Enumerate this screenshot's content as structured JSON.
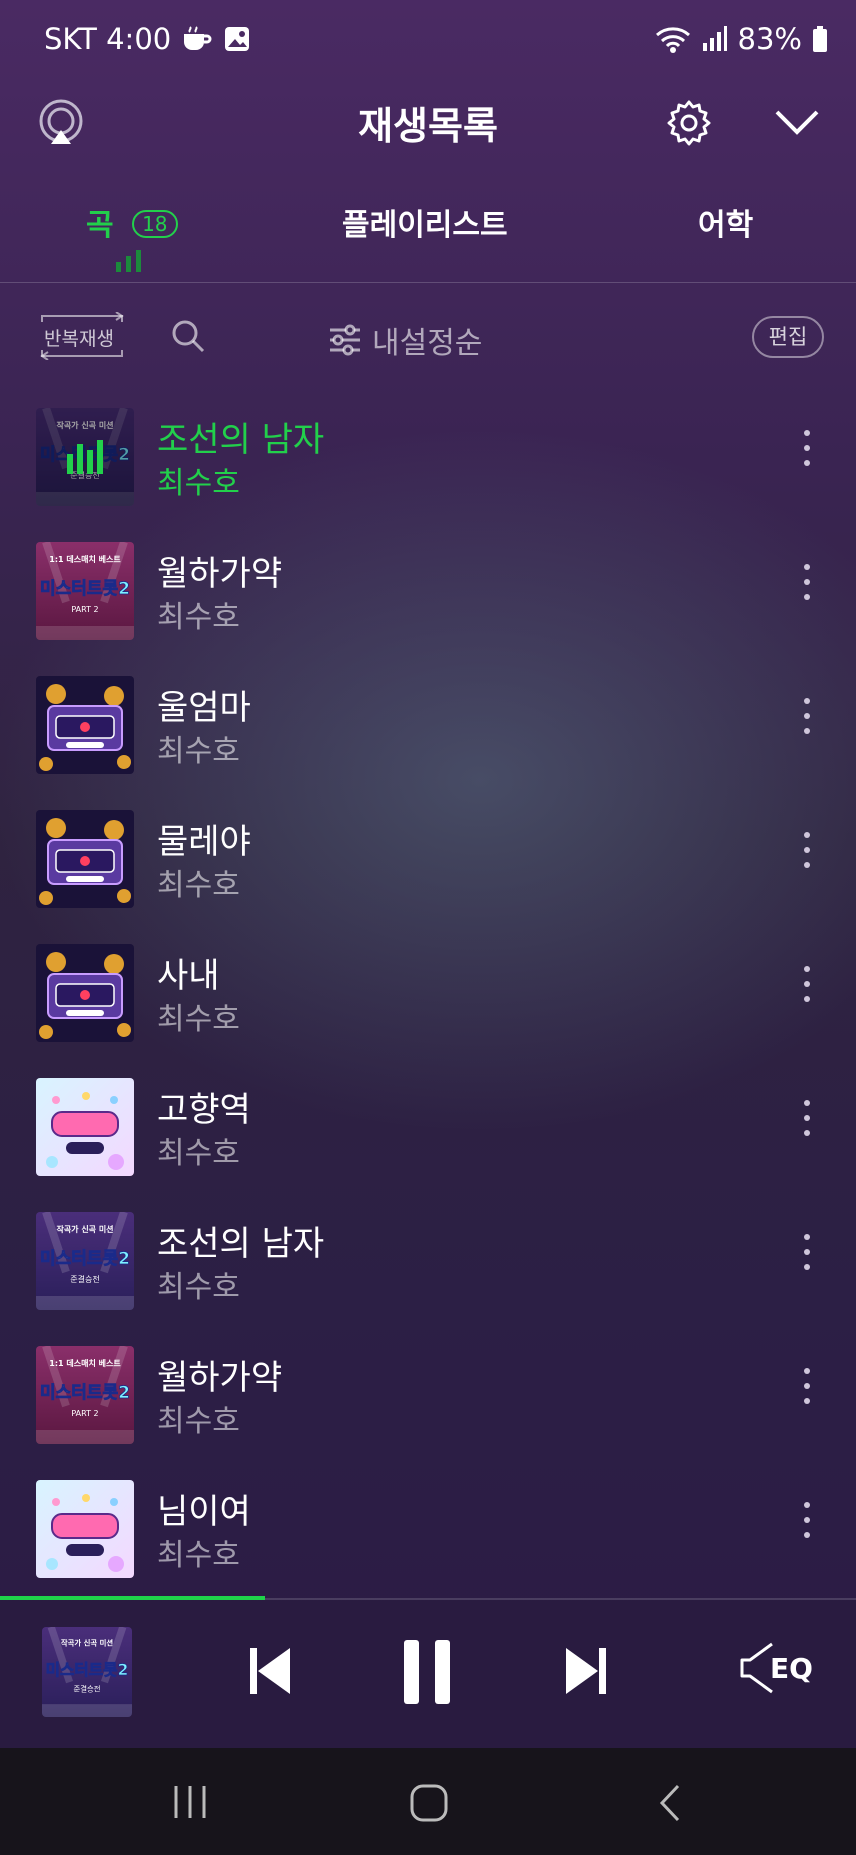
{
  "status_bar": {
    "carrier_time": "SKT 4:00",
    "battery": "83%"
  },
  "header": {
    "title": "재생목록"
  },
  "tabs": [
    {
      "label": "곡",
      "badge": "18",
      "active": true
    },
    {
      "label": "플레이리스트",
      "active": false
    },
    {
      "label": "어학",
      "active": false
    }
  ],
  "toolbar": {
    "repeat_label": "반복재생",
    "sort_label": "내설정순",
    "edit_label": "편집"
  },
  "songs": [
    {
      "title": "조선의 남자",
      "artist": "최수호",
      "playing": true,
      "art": "mistertrot-purple"
    },
    {
      "title": "월하가약",
      "artist": "최수호",
      "playing": false,
      "art": "mistertrot-pink"
    },
    {
      "title": "울엄마",
      "artist": "최수호",
      "playing": false,
      "art": "lotto"
    },
    {
      "title": "물레야",
      "artist": "최수호",
      "playing": false,
      "art": "lotto"
    },
    {
      "title": "사내",
      "artist": "최수호",
      "playing": false,
      "art": "lotto"
    },
    {
      "title": "고향역",
      "artist": "최수호",
      "playing": false,
      "art": "pastel"
    },
    {
      "title": "조선의 남자",
      "artist": "최수호",
      "playing": false,
      "art": "mistertrot-purple"
    },
    {
      "title": "월하가약",
      "artist": "최수호",
      "playing": false,
      "art": "mistertrot-pink"
    },
    {
      "title": "님이여",
      "artist": "최수호",
      "playing": false,
      "art": "pastel"
    }
  ],
  "album_art_text": {
    "mistertrot-purple": {
      "top": "작곡가 신곡 미션",
      "main": "미스터트롯2",
      "bottom": "준결승전"
    },
    "mistertrot-pink": {
      "top": "1:1 데스매치 베스트",
      "main": "미스터트롯2",
      "bottom": "PART 2"
    }
  },
  "player": {
    "progress_fraction": 0.31,
    "eq_label": "EQ",
    "state": "playing"
  },
  "colors": {
    "accent": "#22d04b",
    "bg_top": "#4a2a63",
    "bg_bottom": "#2b1a45"
  },
  "icons": [
    "cup-icon",
    "image-icon",
    "wifi-icon",
    "signal-icon",
    "battery-icon",
    "cast-icon",
    "gear-icon",
    "chevron-down-icon",
    "search-icon",
    "sliders-icon",
    "more-icon",
    "prev-icon",
    "pause-icon",
    "next-icon",
    "eq-speaker-icon",
    "recents-icon",
    "home-icon",
    "back-icon"
  ]
}
